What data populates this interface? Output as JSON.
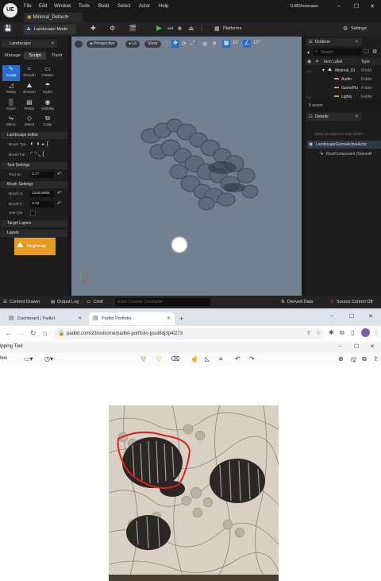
{
  "editor": {
    "logo": "UE",
    "menu": [
      "File",
      "Edit",
      "Window",
      "Tools",
      "Build",
      "Select",
      "Actor",
      "Help"
    ],
    "project_tab": "Minimal_Default•",
    "project_name": "ILMShowcase",
    "toolbar": {
      "mode": "Landscape Mode",
      "platforms": "Platforms",
      "settings": "Settings"
    },
    "landscape_panel": {
      "title": "Landscape",
      "modes": [
        "Manage",
        "Sculpt",
        "Paint"
      ],
      "active_mode": "Sculpt",
      "tools": [
        "Sculpt",
        "Smooth",
        "Flatten",
        "Ramp",
        "Erosion",
        "Hydro",
        "Noise",
        "Retop",
        "Visibility",
        "Mirror",
        "Select",
        "Copy"
      ],
      "sections": {
        "editor": "Landscape Editor",
        "tool_settings": "Tool Settings",
        "brush_settings": "Brush Settings",
        "target_layers": "Target Layers",
        "layers": "Layers"
      },
      "brush_type_label": "Brush Typ.",
      "brush_falloff_label": "Brush Fal",
      "tool_strength_label": "Tool St.",
      "tool_strength": "0.77",
      "brush_size_label": "Brush S.",
      "brush_size": "2249.5865",
      "brush_falloff2_label": "Brush F.",
      "brush_falloff": "0.19",
      "use_clay_label": "Use Cla.",
      "layer_name": "Heightmap"
    },
    "viewport": {
      "perspective": "Perspective",
      "lit": "Lit",
      "show": "Show",
      "grid_value": "10",
      "angle_value": "10°"
    },
    "outliner": {
      "title": "Outliner",
      "search_placeholder": "Search",
      "col_label": "Item Label",
      "col_type": "Type",
      "rows": [
        {
          "label": "Minimal_Di",
          "type": "World"
        },
        {
          "label": "Audio",
          "type": "Folder"
        },
        {
          "label": "GamePlu",
          "type": "Folder"
        },
        {
          "label": "Lights",
          "type": "Folder"
        }
      ],
      "actor_count": "5 actors"
    },
    "details": {
      "title": "Details",
      "hint": "Select an object to view details.",
      "selected": "LandscapeGizmoActiveActor",
      "component": "RootComponent (GizmoR"
    },
    "bottom": {
      "content_drawer": "Content Drawer",
      "output_log": "Output Log",
      "cmd": "Cmd",
      "console_placeholder": "Enter Console Command",
      "derived_data": "Derived Data",
      "source_control": "Source Control Off"
    }
  },
  "browser": {
    "tabs": [
      "Dashboard | Padlet",
      "Padlet Portfolio"
    ],
    "url": "padlet.com/23rosborne/padlet-portfolio-jyssl8dj3p4t273",
    "snipping_title": "ipping Tool",
    "new_label": "lew"
  }
}
